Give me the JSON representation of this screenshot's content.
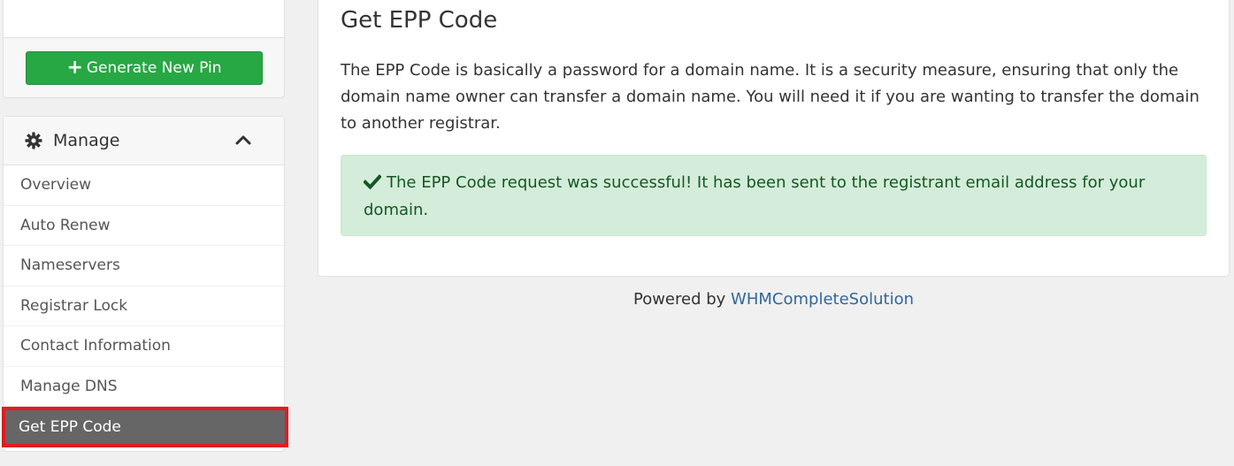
{
  "sidebar": {
    "generate_pin_label": "Generate New Pin",
    "manage": {
      "heading": "Manage",
      "items": [
        {
          "label": "Overview"
        },
        {
          "label": "Auto Renew"
        },
        {
          "label": "Nameservers"
        },
        {
          "label": "Registrar Lock"
        },
        {
          "label": "Contact Information"
        },
        {
          "label": "Manage DNS"
        },
        {
          "label": "Get EPP Code",
          "active": true
        }
      ]
    }
  },
  "main": {
    "title": "Get EPP Code",
    "description": "The EPP Code is basically a password for a domain name. It is a security measure, ensuring that only the domain name owner can transfer a domain name. You will need it if you are wanting to transfer the domain to another registrar.",
    "alert": {
      "message": "The EPP Code request was successful! It has been sent to the registrant email address for your domain.",
      "icon": "check-icon",
      "color": "#155724"
    }
  },
  "footer": {
    "powered_by": "Powered by",
    "link_text": "WHMCompleteSolution"
  },
  "colors": {
    "success": "#28a745",
    "highlight": "#e21b23",
    "active_bg": "#666666",
    "link": "#336699"
  }
}
